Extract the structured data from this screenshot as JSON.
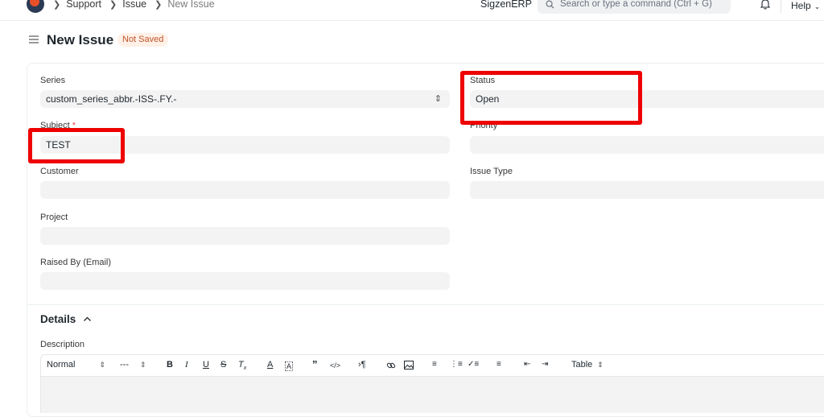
{
  "navbar": {
    "breadcrumbs": [
      "Support",
      "Issue",
      "New Issue"
    ],
    "brand": "SigzenERP",
    "search_placeholder": "Search or type a command (Ctrl + G)",
    "help_label": "Help"
  },
  "header": {
    "title": "New Issue",
    "status_badge": "Not Saved"
  },
  "form": {
    "series": {
      "label": "Series",
      "value": "custom_series_abbr.-ISS-.FY.-"
    },
    "subject": {
      "label": "Subject",
      "required_marker": "*",
      "value": "TEST"
    },
    "customer": {
      "label": "Customer",
      "value": ""
    },
    "project": {
      "label": "Project",
      "value": ""
    },
    "raised_by": {
      "label": "Raised By (Email)",
      "value": ""
    },
    "status": {
      "label": "Status",
      "value": "Open"
    },
    "priority": {
      "label": "Priority",
      "value": ""
    },
    "issue_type": {
      "label": "Issue Type",
      "value": ""
    }
  },
  "details": {
    "title": "Details",
    "description_label": "Description",
    "toolbar": {
      "text_style": "Normal",
      "font_size": "---",
      "table": "Table",
      "buttons": [
        "bold",
        "italic",
        "underline",
        "strike",
        "clear-format",
        "font-color",
        "background-color",
        "blockquote",
        "code-block",
        "direction",
        "link",
        "image",
        "ordered-list",
        "bullet-list",
        "check-list",
        "align",
        "outdent",
        "indent"
      ]
    }
  },
  "colors": {
    "highlight": "#ee0000",
    "badge_bg": "#fff1e7",
    "badge_text": "#c4542a",
    "field_bg": "#f3f3f3"
  }
}
